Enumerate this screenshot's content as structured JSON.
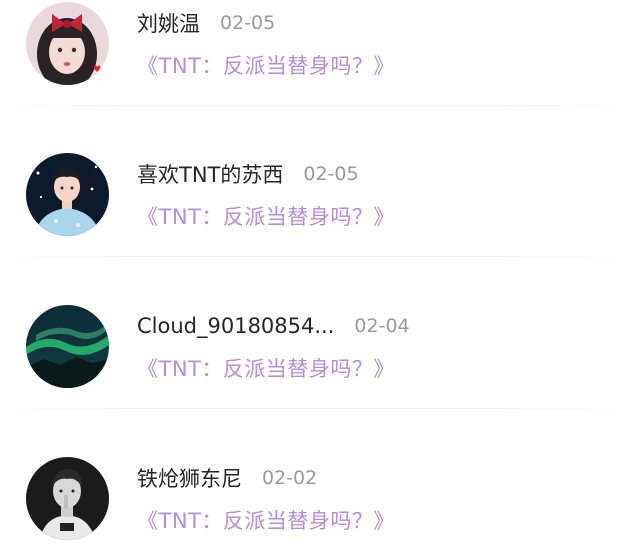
{
  "comments": [
    {
      "user": "刘姚温",
      "date": "02-05",
      "link": "《TNT：反派当替身吗？》",
      "avatar": "girl-with-red-bow-avatar"
    },
    {
      "user": "喜欢TNT的苏西",
      "date": "02-05",
      "link": "《TNT：反派当替身吗？》",
      "avatar": "boy-blue-shirt-avatar"
    },
    {
      "user": "Cloud_90180854...",
      "date": "02-04",
      "link": "《TNT：反派当替身吗？》",
      "avatar": "aurora-landscape-avatar"
    },
    {
      "user": "铁炝狮东尼",
      "date": "02-02",
      "link": "《TNT：反派当替身吗？》",
      "avatar": "black-white-portrait-avatar"
    }
  ],
  "colors": {
    "link": "#b48fd6",
    "name": "#262626",
    "date": "#9a9a9a"
  }
}
